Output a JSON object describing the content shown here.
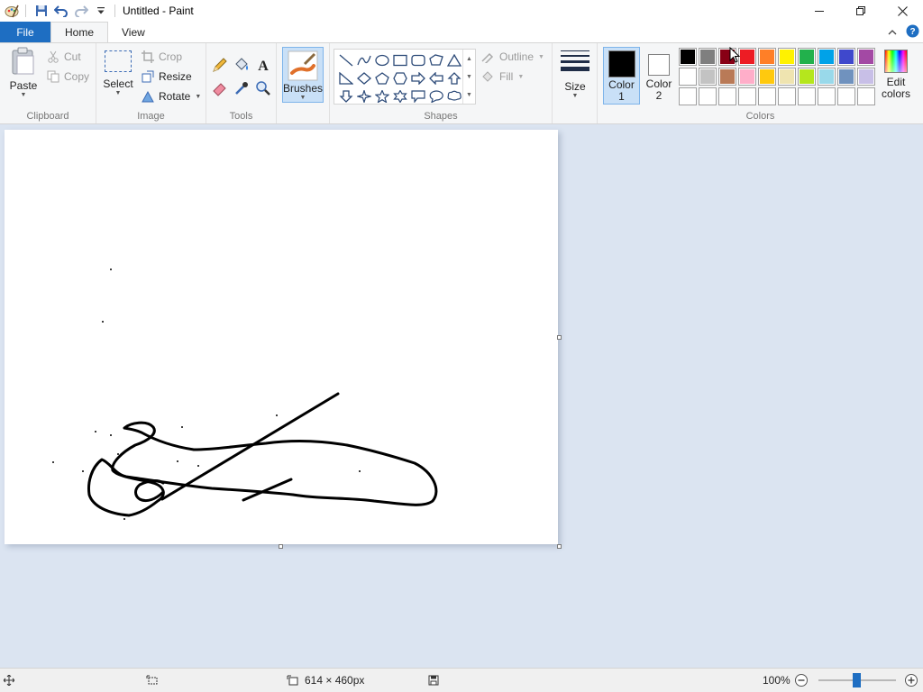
{
  "window": {
    "title": "Untitled - Paint",
    "controls": {
      "minimize": "minimize-icon",
      "maximize": "restore-icon",
      "close": "close-icon"
    }
  },
  "tabs": {
    "file": "File",
    "home": "Home",
    "view": "View",
    "active": "Home"
  },
  "ribbon": {
    "clipboard": {
      "label": "Clipboard",
      "paste": "Paste",
      "cut": "Cut",
      "copy": "Copy"
    },
    "image": {
      "label": "Image",
      "select": "Select",
      "crop": "Crop",
      "resize": "Resize",
      "rotate": "Rotate"
    },
    "tools": {
      "label": "Tools"
    },
    "brushes": {
      "label": "Brushes"
    },
    "shapes": {
      "label": "Shapes",
      "outline": "Outline",
      "fill": "Fill"
    },
    "size": {
      "label": "Size"
    },
    "colors": {
      "label": "Colors",
      "color1_line1": "Color",
      "color1_line2": "1",
      "color2_line1": "Color",
      "color2_line2": "2",
      "edit_line1": "Edit",
      "edit_line2": "colors",
      "color1_value": "#000000",
      "color2_value": "#ffffff",
      "palette_row1": [
        "#000000",
        "#7f7f7f",
        "#880015",
        "#ed1c24",
        "#ff7f27",
        "#fff200",
        "#22b14c",
        "#00a2e8",
        "#3f48cc",
        "#a349a4"
      ],
      "palette_row2": [
        "#ffffff",
        "#c3c3c3",
        "#b97a57",
        "#ffaec9",
        "#ffc90e",
        "#efe4b0",
        "#b5e61d",
        "#99d9ea",
        "#7092be",
        "#c8bfe7"
      ],
      "palette_row3": [
        "#ffffff",
        "#ffffff",
        "#ffffff",
        "#ffffff",
        "#ffffff",
        "#ffffff",
        "#ffffff",
        "#ffffff",
        "#ffffff",
        "#ffffff"
      ]
    }
  },
  "canvas": {
    "background": "#ffffff",
    "stroke_color": "#000000"
  },
  "statusbar": {
    "dimensions": "614 × 460px",
    "zoom": "100%"
  },
  "theme": {
    "accent": "#1e6ec2",
    "workspace": "#dbe4f1",
    "ribbon": "#f5f6f7"
  }
}
